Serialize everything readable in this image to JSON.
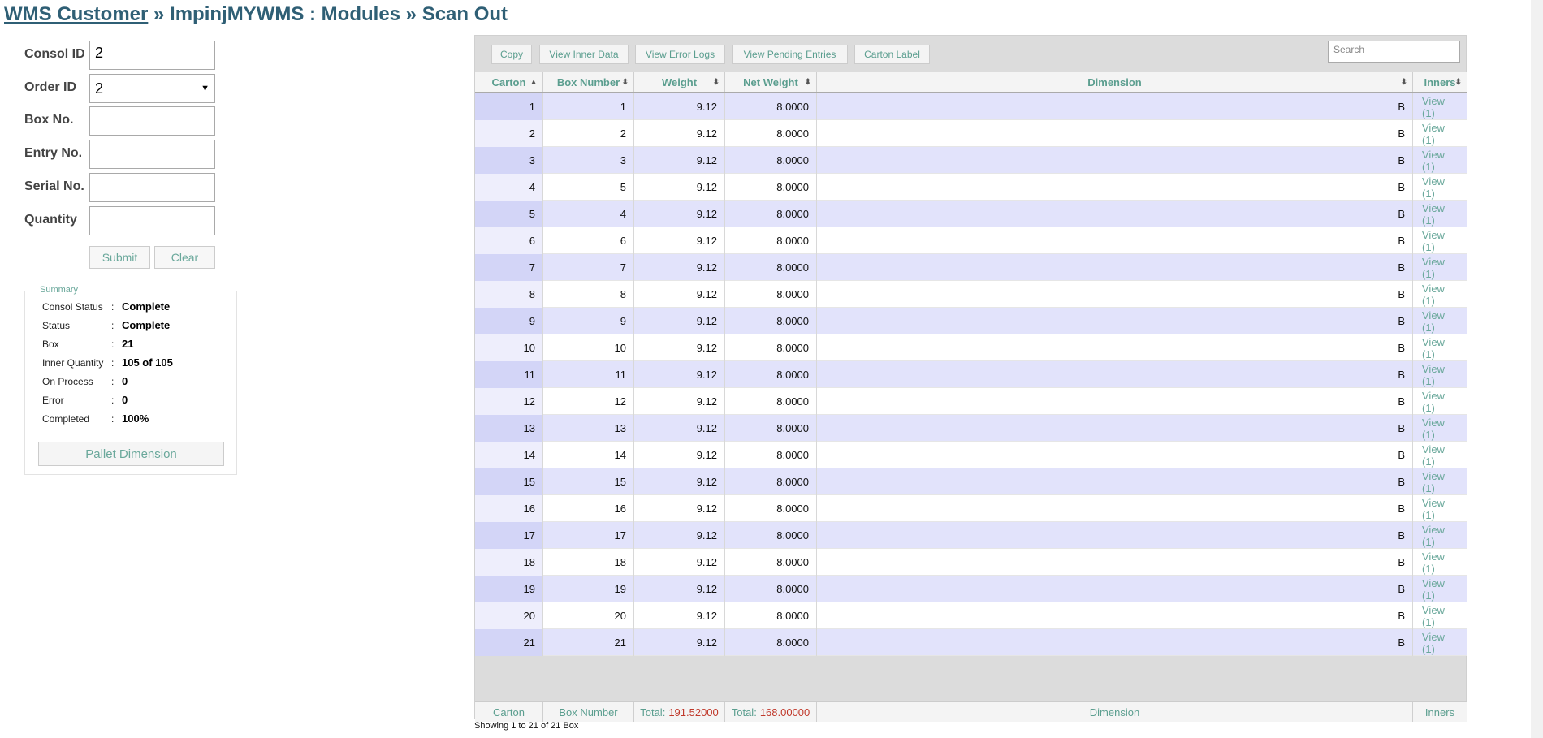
{
  "breadcrumb": {
    "home_link": "WMS Customer",
    "rest": " » ImpinjMYWMS : Modules » Scan Out"
  },
  "form": {
    "consol_label": "Consol ID",
    "consol_value": "2",
    "order_label": "Order ID",
    "order_value": "2",
    "box_label": "Box No.",
    "box_value": "",
    "entry_label": "Entry No.",
    "entry_value": "",
    "serial_label": "Serial No.",
    "serial_value": "",
    "quantity_label": "Quantity",
    "quantity_value": "",
    "submit_label": "Submit",
    "clear_label": "Clear"
  },
  "summary": {
    "legend": "Summary",
    "rows": [
      {
        "label": "Consol Status",
        "value": "Complete"
      },
      {
        "label": "Status",
        "value": "Complete"
      },
      {
        "label": "Box",
        "value": "21"
      },
      {
        "label": "Inner Quantity",
        "value": "105 of 105"
      },
      {
        "label": "On Process",
        "value": "0"
      },
      {
        "label": "Error",
        "value": "0"
      },
      {
        "label": "Completed",
        "value": "100%"
      }
    ],
    "colon": ":",
    "pallet_button": "Pallet Dimension"
  },
  "toolbar": {
    "copy": "Copy",
    "view_inner": "View Inner Data",
    "view_error": "View Error Logs",
    "view_pending": "View Pending Entries",
    "carton_label": "Carton Label",
    "search_placeholder": "Search"
  },
  "table": {
    "headers": [
      "Carton",
      "Box Number",
      "Weight",
      "Net Weight",
      "Dimension",
      "Inners"
    ],
    "sort_asc_icon": "▲",
    "sort_both_icon": "⬍",
    "rows": [
      {
        "carton": "1",
        "box": "1",
        "weight": "9.12",
        "net": "8.0000",
        "dim": "B",
        "inners": "View (1)"
      },
      {
        "carton": "2",
        "box": "2",
        "weight": "9.12",
        "net": "8.0000",
        "dim": "B",
        "inners": "View (1)"
      },
      {
        "carton": "3",
        "box": "3",
        "weight": "9.12",
        "net": "8.0000",
        "dim": "B",
        "inners": "View (1)"
      },
      {
        "carton": "4",
        "box": "5",
        "weight": "9.12",
        "net": "8.0000",
        "dim": "B",
        "inners": "View (1)"
      },
      {
        "carton": "5",
        "box": "4",
        "weight": "9.12",
        "net": "8.0000",
        "dim": "B",
        "inners": "View (1)"
      },
      {
        "carton": "6",
        "box": "6",
        "weight": "9.12",
        "net": "8.0000",
        "dim": "B",
        "inners": "View (1)"
      },
      {
        "carton": "7",
        "box": "7",
        "weight": "9.12",
        "net": "8.0000",
        "dim": "B",
        "inners": "View (1)"
      },
      {
        "carton": "8",
        "box": "8",
        "weight": "9.12",
        "net": "8.0000",
        "dim": "B",
        "inners": "View (1)"
      },
      {
        "carton": "9",
        "box": "9",
        "weight": "9.12",
        "net": "8.0000",
        "dim": "B",
        "inners": "View (1)"
      },
      {
        "carton": "10",
        "box": "10",
        "weight": "9.12",
        "net": "8.0000",
        "dim": "B",
        "inners": "View (1)"
      },
      {
        "carton": "11",
        "box": "11",
        "weight": "9.12",
        "net": "8.0000",
        "dim": "B",
        "inners": "View (1)"
      },
      {
        "carton": "12",
        "box": "12",
        "weight": "9.12",
        "net": "8.0000",
        "dim": "B",
        "inners": "View (1)"
      },
      {
        "carton": "13",
        "box": "13",
        "weight": "9.12",
        "net": "8.0000",
        "dim": "B",
        "inners": "View (1)"
      },
      {
        "carton": "14",
        "box": "14",
        "weight": "9.12",
        "net": "8.0000",
        "dim": "B",
        "inners": "View (1)"
      },
      {
        "carton": "15",
        "box": "15",
        "weight": "9.12",
        "net": "8.0000",
        "dim": "B",
        "inners": "View (1)"
      },
      {
        "carton": "16",
        "box": "16",
        "weight": "9.12",
        "net": "8.0000",
        "dim": "B",
        "inners": "View (1)"
      },
      {
        "carton": "17",
        "box": "17",
        "weight": "9.12",
        "net": "8.0000",
        "dim": "B",
        "inners": "View (1)"
      },
      {
        "carton": "18",
        "box": "18",
        "weight": "9.12",
        "net": "8.0000",
        "dim": "B",
        "inners": "View (1)"
      },
      {
        "carton": "19",
        "box": "19",
        "weight": "9.12",
        "net": "8.0000",
        "dim": "B",
        "inners": "View (1)"
      },
      {
        "carton": "20",
        "box": "20",
        "weight": "9.12",
        "net": "8.0000",
        "dim": "B",
        "inners": "View (1)"
      },
      {
        "carton": "21",
        "box": "21",
        "weight": "9.12",
        "net": "8.0000",
        "dim": "B",
        "inners": "View (1)"
      }
    ],
    "footer": {
      "carton": "Carton",
      "box": "Box Number",
      "total_label": "Total:",
      "weight_total": "191.52000",
      "net_total": "168.00000",
      "dimension": "Dimension",
      "inners": "Inners"
    },
    "info": "Showing 1 to 21 of 21 Box"
  },
  "colors": {
    "title": "#2f5f75",
    "accent": "#6aa89b",
    "row_odd": "#e2e3fb",
    "total": "#c0392b"
  }
}
